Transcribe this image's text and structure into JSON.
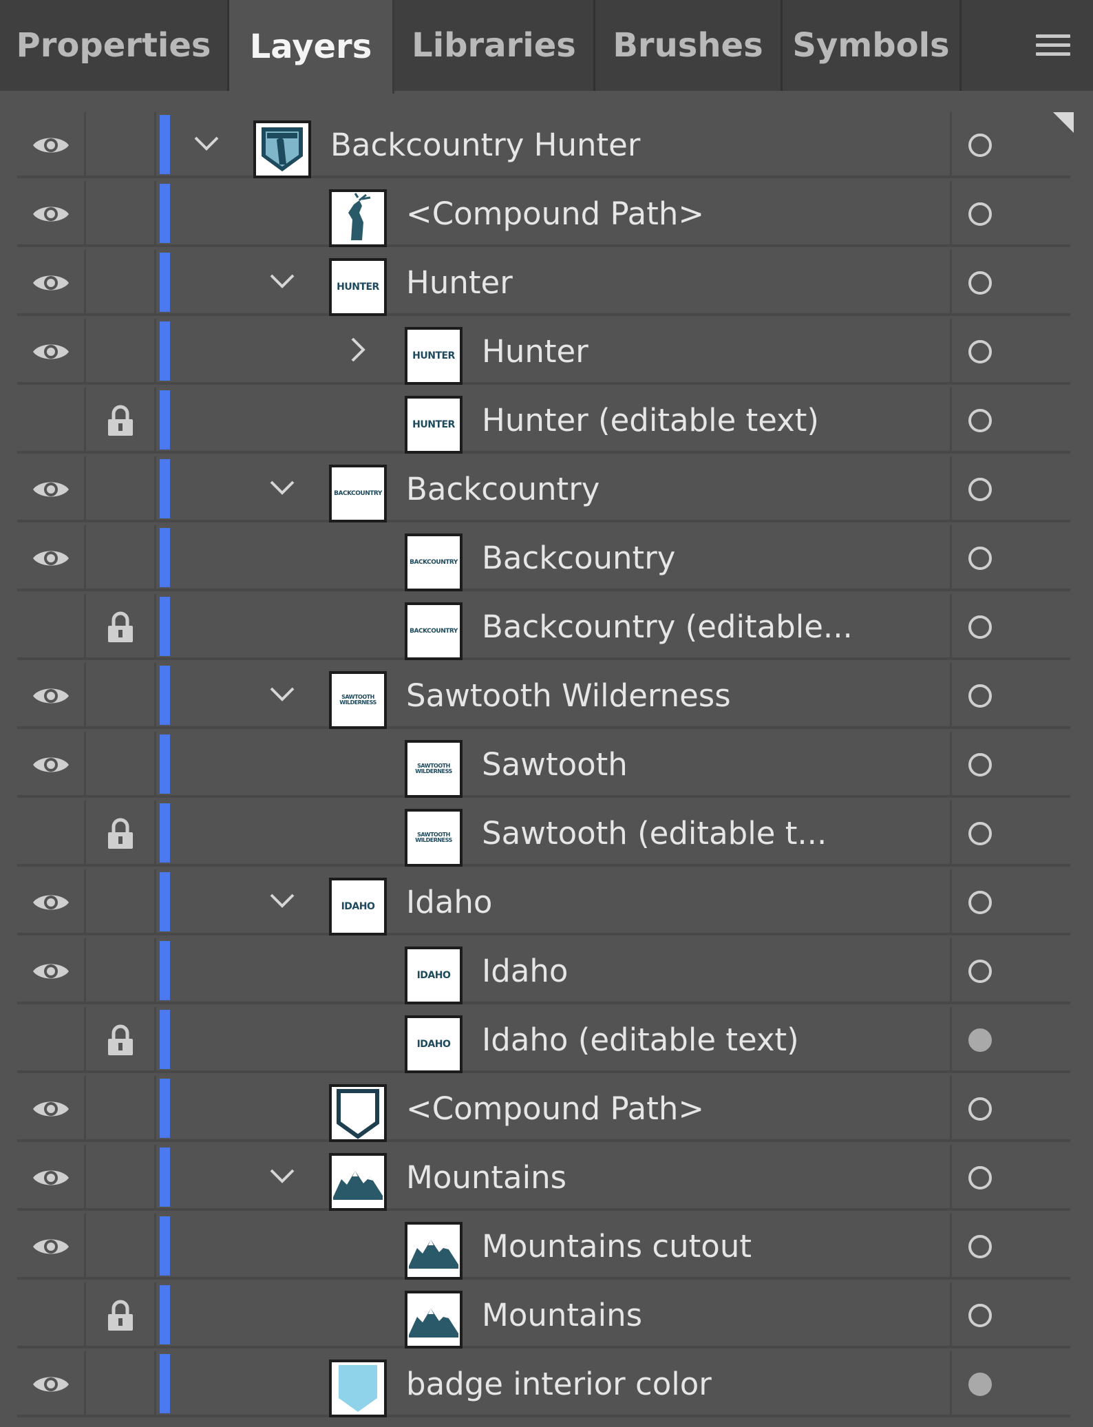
{
  "tabs": [
    {
      "label": "Properties",
      "active": false
    },
    {
      "label": "Layers",
      "active": true
    },
    {
      "label": "Libraries",
      "active": false
    },
    {
      "label": "Brushes",
      "active": false
    },
    {
      "label": "Symbols",
      "active": false
    }
  ],
  "menu_icon": "hamburger-menu-icon",
  "accent_color": "#4a79f0",
  "layers": [
    {
      "name": "Backcountry Hunter",
      "depth": 0,
      "visible": true,
      "locked": false,
      "expander": "expanded",
      "thumb": "badge",
      "thumb_text": "",
      "target": "empty"
    },
    {
      "name": "<Compound Path>",
      "depth": 1,
      "visible": true,
      "locked": false,
      "expander": "none",
      "thumb": "hunter-figure",
      "thumb_text": "",
      "target": "empty"
    },
    {
      "name": "Hunter",
      "depth": 1,
      "visible": true,
      "locked": false,
      "expander": "expanded",
      "thumb": "text",
      "thumb_text": "HUNTER",
      "target": "empty"
    },
    {
      "name": "Hunter",
      "depth": 2,
      "visible": true,
      "locked": false,
      "expander": "collapsed",
      "thumb": "text",
      "thumb_text": "HUNTER",
      "target": "empty"
    },
    {
      "name": "Hunter (editable text)",
      "depth": 2,
      "visible": false,
      "locked": true,
      "expander": "none",
      "thumb": "text",
      "thumb_text": "HUNTER",
      "target": "empty"
    },
    {
      "name": "Backcountry",
      "depth": 1,
      "visible": true,
      "locked": false,
      "expander": "expanded",
      "thumb": "text-small",
      "thumb_text": "BACKCOUNTRY",
      "target": "empty"
    },
    {
      "name": "Backcountry",
      "depth": 2,
      "visible": true,
      "locked": false,
      "expander": "none",
      "thumb": "text-small",
      "thumb_text": "BACKCOUNTRY",
      "target": "empty"
    },
    {
      "name": "Backcountry (editable...",
      "depth": 2,
      "visible": false,
      "locked": true,
      "expander": "none",
      "thumb": "text-small",
      "thumb_text": "BACKCOUNTRY",
      "target": "empty"
    },
    {
      "name": "Sawtooth Wilderness",
      "depth": 1,
      "visible": true,
      "locked": false,
      "expander": "expanded",
      "thumb": "text-tiny",
      "thumb_text": "SAWTOOTH WILDERNESS",
      "target": "empty"
    },
    {
      "name": "Sawtooth",
      "depth": 2,
      "visible": true,
      "locked": false,
      "expander": "none",
      "thumb": "text-tiny",
      "thumb_text": "SAWTOOTH WILDERNESS",
      "target": "empty"
    },
    {
      "name": "Sawtooth (editable t...",
      "depth": 2,
      "visible": false,
      "locked": true,
      "expander": "none",
      "thumb": "text-tiny",
      "thumb_text": "SAWTOOTH WILDERNESS",
      "target": "empty"
    },
    {
      "name": "Idaho",
      "depth": 1,
      "visible": true,
      "locked": false,
      "expander": "expanded",
      "thumb": "text",
      "thumb_text": "IDAHO",
      "target": "empty"
    },
    {
      "name": "Idaho",
      "depth": 2,
      "visible": true,
      "locked": false,
      "expander": "none",
      "thumb": "text",
      "thumb_text": "IDAHO",
      "target": "empty"
    },
    {
      "name": "Idaho (editable text)",
      "depth": 2,
      "visible": false,
      "locked": true,
      "expander": "none",
      "thumb": "text",
      "thumb_text": "IDAHO",
      "target": "filled"
    },
    {
      "name": "<Compound Path>",
      "depth": 1,
      "visible": true,
      "locked": false,
      "expander": "none",
      "thumb": "shield-outline",
      "thumb_text": "",
      "target": "empty"
    },
    {
      "name": "Mountains",
      "depth": 1,
      "visible": true,
      "locked": false,
      "expander": "expanded",
      "thumb": "mountains",
      "thumb_text": "",
      "target": "empty"
    },
    {
      "name": "Mountains cutout",
      "depth": 2,
      "visible": true,
      "locked": false,
      "expander": "none",
      "thumb": "mountains",
      "thumb_text": "",
      "target": "empty"
    },
    {
      "name": "Mountains",
      "depth": 2,
      "visible": false,
      "locked": true,
      "expander": "none",
      "thumb": "mountains",
      "thumb_text": "",
      "target": "empty"
    },
    {
      "name": "badge interior color",
      "depth": 1,
      "visible": true,
      "locked": false,
      "expander": "none",
      "thumb": "shield-filled",
      "thumb_text": "",
      "target": "filled"
    }
  ]
}
